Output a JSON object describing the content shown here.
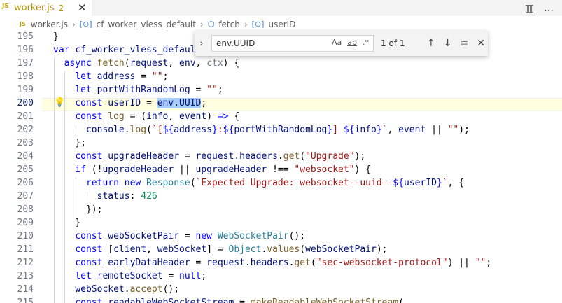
{
  "tab": {
    "badge": "JS",
    "name": "worker.js",
    "count": "2",
    "close": "✕"
  },
  "tabbar_actions": {
    "split": "▥",
    "more": "…"
  },
  "breadcrumb": {
    "js": "JS",
    "file": "worker.js",
    "sep": "›",
    "sym1_icon": "[⊙]",
    "sym1": "cf_worker_vless_default",
    "sym2_icon": "⬡",
    "sym2": "fetch",
    "sym3_icon": "[⊙]",
    "sym3": "userID"
  },
  "find": {
    "toggle": "›",
    "value": "env.UUID",
    "opt_case": "Aa",
    "opt_word": "ab",
    "opt_regex": ".*",
    "count": "1 of 1",
    "up": "↑",
    "down": "↓",
    "selection": "≡",
    "close": "✕"
  },
  "line_numbers": [
    "195",
    "196",
    "197",
    "198",
    "199",
    "200",
    "201",
    "202",
    "203",
    "204",
    "205",
    "206",
    "207",
    "208",
    "209",
    "210",
    "211",
    "212",
    "213",
    "214",
    "215"
  ],
  "active_line": "200",
  "bulb": "💡",
  "icons": {
    "tab_close": "close-icon",
    "find_close": "close-icon",
    "bulb": "lightbulb-icon"
  }
}
